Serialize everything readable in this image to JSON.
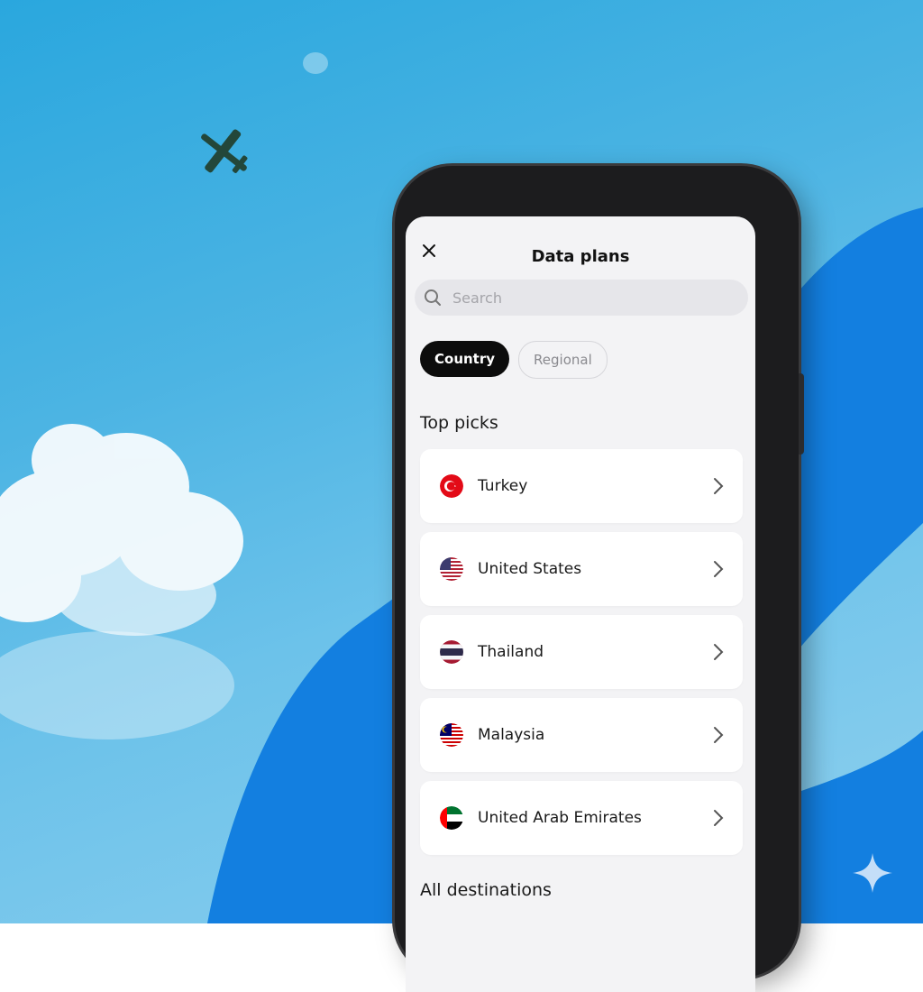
{
  "screen": {
    "title": "Data plans",
    "search": {
      "placeholder": "Search"
    },
    "tabs": [
      {
        "label": "Country",
        "active": true
      },
      {
        "label": "Regional",
        "active": false
      }
    ],
    "top_picks": {
      "heading": "Top picks",
      "items": [
        {
          "label": "Turkey",
          "flag": "turkey-flag-icon"
        },
        {
          "label": "United States",
          "flag": "us-flag-icon"
        },
        {
          "label": "Thailand",
          "flag": "thailand-flag-icon"
        },
        {
          "label": "Malaysia",
          "flag": "malaysia-flag-icon"
        },
        {
          "label": "United Arab Emirates",
          "flag": "uae-flag-icon"
        }
      ]
    },
    "all_destinations": {
      "heading": "All destinations"
    }
  },
  "colors": {
    "sky": "#4cb4e3",
    "wave": "#137fe0",
    "active_chip": "#0c0c0c"
  }
}
